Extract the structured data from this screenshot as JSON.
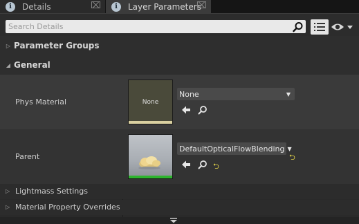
{
  "tabs": [
    {
      "label": "Details",
      "icon": "info-icon",
      "close": "⌧"
    },
    {
      "label": "Layer Parameters",
      "icon": "info-icon",
      "close": "⌧"
    }
  ],
  "search": {
    "placeholder": "Search Details",
    "value": ""
  },
  "categories": {
    "parameter_groups": "Parameter Groups",
    "general": "General"
  },
  "properties": {
    "phys_material": {
      "label": "Phys Material",
      "thumbnail_text": "None",
      "value": "None"
    },
    "parent": {
      "label": "Parent",
      "value": "DefaultOpticalFlowBlending"
    }
  },
  "sub_categories": {
    "lightmass": "Lightmass Settings",
    "material_overrides": "Material Property Overrides"
  },
  "colors": {
    "reset_arrow": "#e8d84a",
    "parent_thumb_bar": "#2db52d",
    "none_thumb_bar": "#d9cfa0"
  }
}
